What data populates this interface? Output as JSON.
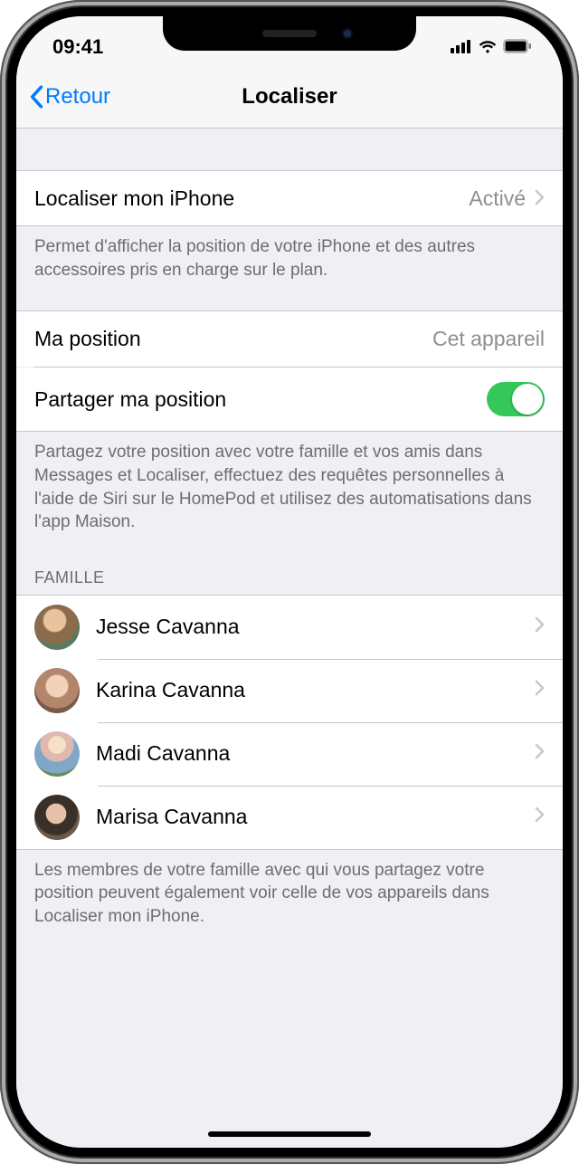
{
  "status": {
    "time": "09:41"
  },
  "nav": {
    "back": "Retour",
    "title": "Localiser"
  },
  "find_iphone": {
    "label": "Localiser mon iPhone",
    "value": "Activé"
  },
  "find_iphone_footer": "Permet d'afficher la position de votre iPhone et des autres accessoires pris en charge sur le plan.",
  "my_location": {
    "label": "Ma position",
    "value": "Cet appareil"
  },
  "share_location": {
    "label": "Partager ma position",
    "on": true
  },
  "share_footer": "Partagez votre position avec votre famille et vos amis dans Messages et Localiser, effectuez des requêtes personnelles à l'aide de Siri sur le HomePod et utilisez des automatisations dans l'app Maison.",
  "family_header": "FAMILLE",
  "family": [
    {
      "name": "Jesse Cavanna",
      "avatar_bg": "radial-gradient(circle at 45% 35%, #e8c39e 0 28%, #8a6b4a 32% 60%, #5a7a60 62% 100%)"
    },
    {
      "name": "Karina Cavanna",
      "avatar_bg": "radial-gradient(circle at 50% 40%, #f2d2b8 0 30%, #b1866a 34% 62%, #7a5a4a 64% 100%)"
    },
    {
      "name": "Madi Cavanna",
      "avatar_bg": "radial-gradient(circle at 50% 30%, #f5e0c8 0 22%, #e0b8b0 24% 42%, #7fa8c8 44% 72%, #6a8a5a 74% 100%)"
    },
    {
      "name": "Marisa Cavanna",
      "avatar_bg": "radial-gradient(circle at 48% 42%, #e8c2a8 0 28%, #3a302a 30% 60%, #6a5a4a 62% 100%)"
    }
  ],
  "family_footer": "Les membres de votre famille avec qui vous partagez votre position peuvent également voir celle de vos appareils dans Localiser mon iPhone."
}
